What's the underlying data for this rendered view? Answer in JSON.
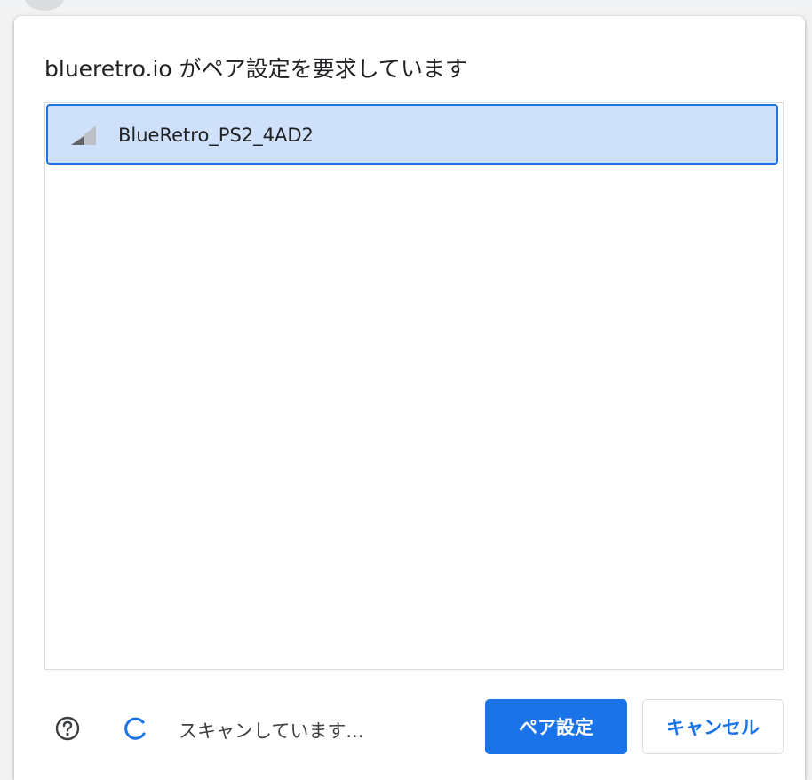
{
  "dialog": {
    "title": "blueretro.io がペア設定を要求しています"
  },
  "devices": [
    {
      "name": "BlueRetro_PS2_4AD2",
      "icon": "signal-strength-icon",
      "selected": true
    }
  ],
  "footer": {
    "help_icon": "help-circle-icon",
    "spinner_icon": "spinner-icon",
    "status": "スキャンしています...",
    "pair_label": "ペア設定",
    "cancel_label": "キャンセル"
  },
  "colors": {
    "accent": "#1a73e8",
    "selected_row": "#cfe0fb",
    "title_text": "#202124"
  }
}
